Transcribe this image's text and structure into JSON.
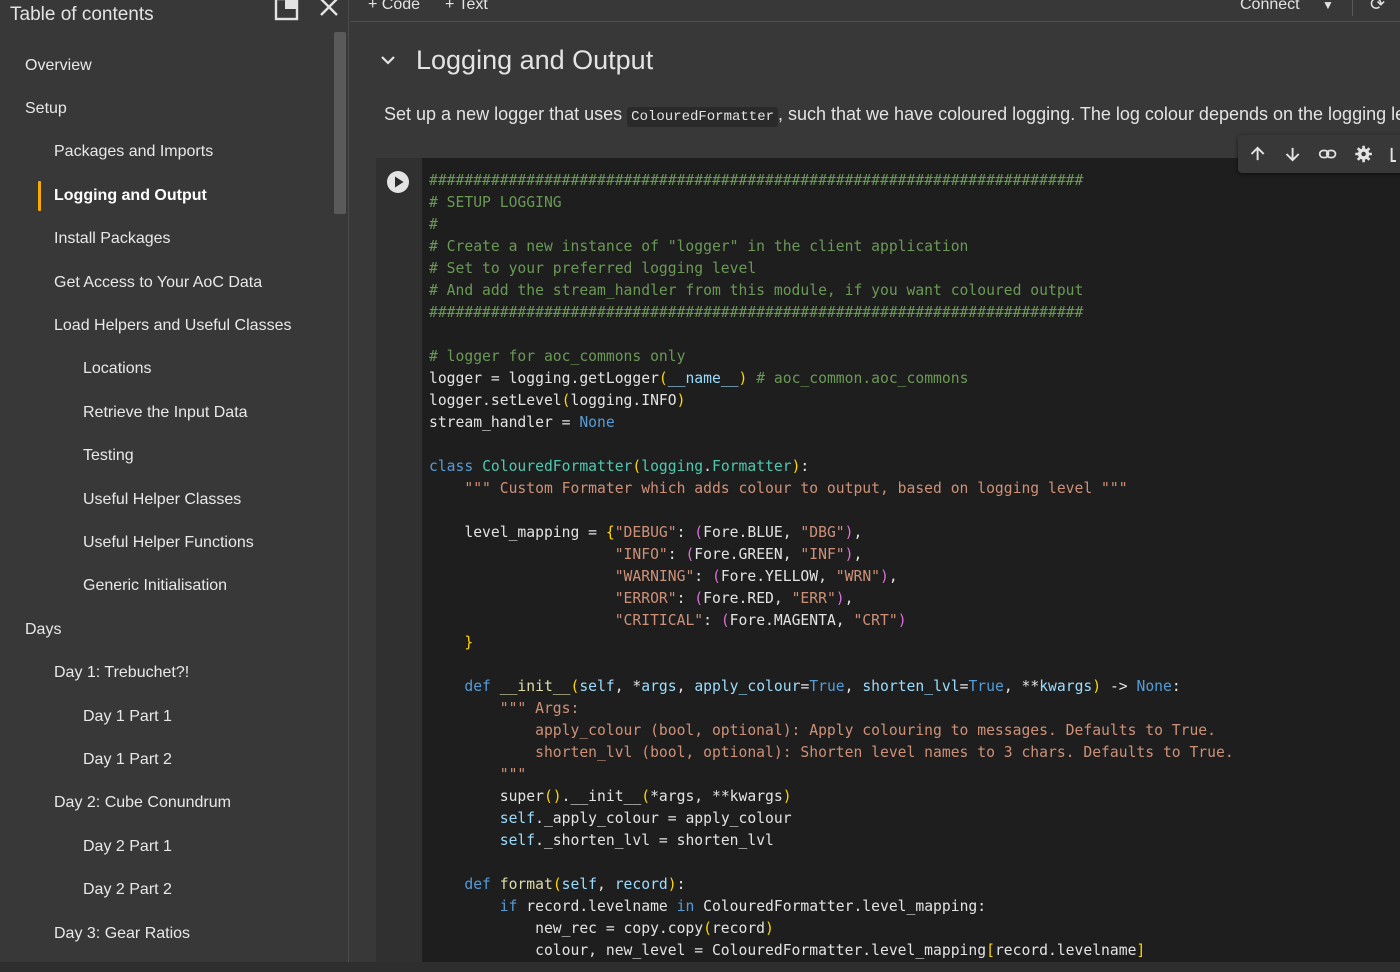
{
  "sidebar": {
    "title": "Table of contents",
    "items": [
      {
        "label": "Overview",
        "level": 1,
        "active": false
      },
      {
        "label": "Setup",
        "level": 1,
        "active": false
      },
      {
        "label": "Packages and Imports",
        "level": 2,
        "active": false
      },
      {
        "label": "Logging and Output",
        "level": 2,
        "active": true
      },
      {
        "label": "Install Packages",
        "level": 2,
        "active": false
      },
      {
        "label": "Get Access to Your AoC Data",
        "level": 2,
        "active": false
      },
      {
        "label": "Load Helpers and Useful Classes",
        "level": 2,
        "active": false
      },
      {
        "label": "Locations",
        "level": 3,
        "active": false
      },
      {
        "label": "Retrieve the Input Data",
        "level": 3,
        "active": false
      },
      {
        "label": "Testing",
        "level": 3,
        "active": false
      },
      {
        "label": "Useful Helper Classes",
        "level": 3,
        "active": false
      },
      {
        "label": "Useful Helper Functions",
        "level": 3,
        "active": false
      },
      {
        "label": "Generic Initialisation",
        "level": 3,
        "active": false
      },
      {
        "label": "Days",
        "level": 1,
        "active": false
      },
      {
        "label": "Day 1: Trebuchet?!",
        "level": 2,
        "active": false
      },
      {
        "label": "Day 1 Part 1",
        "level": 3,
        "active": false
      },
      {
        "label": "Day 1 Part 2",
        "level": 3,
        "active": false
      },
      {
        "label": "Day 2: Cube Conundrum",
        "level": 2,
        "active": false
      },
      {
        "label": "Day 2 Part 1",
        "level": 3,
        "active": false
      },
      {
        "label": "Day 2 Part 2",
        "level": 3,
        "active": false
      },
      {
        "label": "Day 3: Gear Ratios",
        "level": 2,
        "active": false
      }
    ]
  },
  "toolbar": {
    "code_label": "+ Code",
    "text_label": "+ Text",
    "connect_label": "Connect"
  },
  "section": {
    "title": "Logging and Output",
    "desc_before": "Set up a new logger that uses ",
    "desc_code": "ColouredFormatter",
    "desc_after": ", such that we have coloured logging. The log colour depends on the logging level."
  },
  "code_lines": [
    [
      [
        "c-com",
        "##########################################################################"
      ]
    ],
    [
      [
        "c-com",
        "# SETUP LOGGING"
      ]
    ],
    [
      [
        "c-com",
        "#"
      ]
    ],
    [
      [
        "c-com",
        "# Create a new instance of \"logger\" in the client application"
      ]
    ],
    [
      [
        "c-com",
        "# Set to your preferred logging level"
      ]
    ],
    [
      [
        "c-com",
        "# And add the stream_handler from this module, if you want coloured output"
      ]
    ],
    [
      [
        "c-com",
        "##########################################################################"
      ]
    ],
    [],
    [
      [
        "c-com",
        "# logger for aoc_commons only"
      ]
    ],
    [
      [
        "",
        "logger = logging.getLogger"
      ],
      [
        "c-br1",
        "("
      ],
      [
        "c-var",
        "__name__"
      ],
      [
        "c-br1",
        ")"
      ],
      [
        "c-com",
        " # aoc_common.aoc_commons"
      ]
    ],
    [
      [
        "",
        "logger.setLevel"
      ],
      [
        "c-br1",
        "("
      ],
      [
        "",
        "logging.INFO"
      ],
      [
        "c-br1",
        ")"
      ]
    ],
    [
      [
        "",
        "stream_handler = "
      ],
      [
        "c-kw",
        "None"
      ]
    ],
    [],
    [
      [
        "c-kw",
        "class "
      ],
      [
        "c-cls",
        "ColouredFormatter"
      ],
      [
        "c-br1",
        "("
      ],
      [
        "c-cls",
        "logging"
      ],
      [
        "",
        "."
      ],
      [
        "c-cls",
        "Formatter"
      ],
      [
        "c-br1",
        ")"
      ],
      [
        "",
        ":"
      ]
    ],
    [
      [
        "c-str",
        "    \"\"\" Custom Formater which adds colour to output, based on logging level \"\"\""
      ]
    ],
    [],
    [
      [
        "",
        "    level_mapping = "
      ],
      [
        "c-br1",
        "{"
      ],
      [
        "c-str",
        "\"DEBUG\""
      ],
      [
        "",
        ": "
      ],
      [
        "c-br2",
        "("
      ],
      [
        "",
        "Fore.BLUE, "
      ],
      [
        "c-str",
        "\"DBG\""
      ],
      [
        "c-br2",
        ")"
      ],
      [
        "",
        ","
      ]
    ],
    [
      [
        "",
        "                     "
      ],
      [
        "c-str",
        "\"INFO\""
      ],
      [
        "",
        ": "
      ],
      [
        "c-br2",
        "("
      ],
      [
        "",
        "Fore.GREEN, "
      ],
      [
        "c-str",
        "\"INF\""
      ],
      [
        "c-br2",
        ")"
      ],
      [
        "",
        ","
      ]
    ],
    [
      [
        "",
        "                     "
      ],
      [
        "c-str",
        "\"WARNING\""
      ],
      [
        "",
        ": "
      ],
      [
        "c-br2",
        "("
      ],
      [
        "",
        "Fore.YELLOW, "
      ],
      [
        "c-str",
        "\"WRN\""
      ],
      [
        "c-br2",
        ")"
      ],
      [
        "",
        ","
      ]
    ],
    [
      [
        "",
        "                     "
      ],
      [
        "c-str",
        "\"ERROR\""
      ],
      [
        "",
        ": "
      ],
      [
        "c-br2",
        "("
      ],
      [
        "",
        "Fore.RED, "
      ],
      [
        "c-str",
        "\"ERR\""
      ],
      [
        "c-br2",
        ")"
      ],
      [
        "",
        ","
      ]
    ],
    [
      [
        "",
        "                     "
      ],
      [
        "c-str",
        "\"CRITICAL\""
      ],
      [
        "",
        ": "
      ],
      [
        "c-br2",
        "("
      ],
      [
        "",
        "Fore.MAGENTA, "
      ],
      [
        "c-str",
        "\"CRT\""
      ],
      [
        "c-br2",
        ")"
      ]
    ],
    [
      [
        "",
        "    "
      ],
      [
        "c-br1",
        "}"
      ]
    ],
    [],
    [
      [
        "c-kw",
        "    def "
      ],
      [
        "c-fn",
        "__init__"
      ],
      [
        "c-br1",
        "("
      ],
      [
        "c-var",
        "self"
      ],
      [
        "",
        ", *"
      ],
      [
        "c-var",
        "args"
      ],
      [
        "",
        ", "
      ],
      [
        "c-var",
        "apply_colour"
      ],
      [
        "",
        "="
      ],
      [
        "c-kw",
        "True"
      ],
      [
        "",
        ", "
      ],
      [
        "c-var",
        "shorten_lvl"
      ],
      [
        "",
        "="
      ],
      [
        "c-kw",
        "True"
      ],
      [
        "",
        ", **"
      ],
      [
        "c-var",
        "kwargs"
      ],
      [
        "c-br1",
        ")"
      ],
      [
        "",
        " -> "
      ],
      [
        "c-kw",
        "None"
      ],
      [
        "",
        ":"
      ]
    ],
    [
      [
        "c-str",
        "        \"\"\" Args:"
      ]
    ],
    [
      [
        "c-str",
        "            apply_colour (bool, optional): Apply colouring to messages. Defaults to True."
      ]
    ],
    [
      [
        "c-str",
        "            shorten_lvl (bool, optional): Shorten level names to 3 chars. Defaults to True."
      ]
    ],
    [
      [
        "c-str",
        "        \"\"\""
      ]
    ],
    [
      [
        "",
        "        super"
      ],
      [
        "c-br1",
        "()"
      ],
      [
        "",
        ".__init__"
      ],
      [
        "c-br1",
        "("
      ],
      [
        "",
        "*args, **kwargs"
      ],
      [
        "c-br1",
        ")"
      ]
    ],
    [
      [
        "c-var",
        "        self"
      ],
      [
        "",
        "._apply_colour = apply_colour"
      ]
    ],
    [
      [
        "c-var",
        "        self"
      ],
      [
        "",
        "._shorten_lvl = shorten_lvl"
      ]
    ],
    [],
    [
      [
        "c-kw",
        "    def "
      ],
      [
        "c-fn",
        "format"
      ],
      [
        "c-br1",
        "("
      ],
      [
        "c-var",
        "self"
      ],
      [
        "",
        ", "
      ],
      [
        "c-var",
        "record"
      ],
      [
        "c-br1",
        ")"
      ],
      [
        "",
        ":"
      ]
    ],
    [
      [
        "c-kw",
        "        if "
      ],
      [
        "",
        "record.levelname "
      ],
      [
        "c-kw",
        "in"
      ],
      [
        "",
        " ColouredFormatter.level_mapping:"
      ]
    ],
    [
      [
        "",
        "            new_rec = copy.copy"
      ],
      [
        "c-br1",
        "("
      ],
      [
        "",
        "record"
      ],
      [
        "c-br1",
        ")"
      ]
    ],
    [
      [
        "",
        "            colour, new_level = ColouredFormatter.level_mapping"
      ],
      [
        "c-br1",
        "["
      ],
      [
        "",
        "record.levelname"
      ],
      [
        "c-br1",
        "]"
      ]
    ]
  ]
}
